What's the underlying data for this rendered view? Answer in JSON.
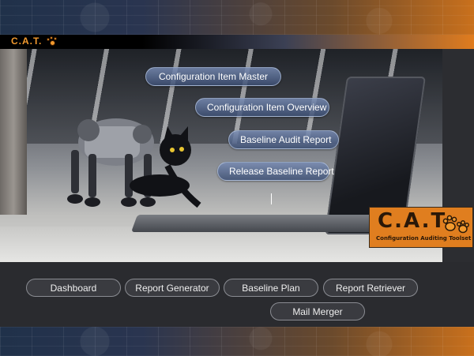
{
  "app": {
    "brand": "C.A.T.",
    "logo_title": "C.A.T.",
    "logo_subtitle": "Configuration Auditing Toolset"
  },
  "hero_links": [
    {
      "label": "Configuration Item Master"
    },
    {
      "label": "Configuration Item Overview"
    },
    {
      "label": "Baseline Audit Report"
    },
    {
      "label": "Release Baseline Report"
    }
  ],
  "nav": [
    {
      "label": "Dashboard"
    },
    {
      "label": "Report Generator"
    },
    {
      "label": "Baseline Plan"
    },
    {
      "label": "Report Retriever"
    },
    {
      "label": "Mail Merger"
    }
  ],
  "colors": {
    "accent": "#f29a2e",
    "logo_bg": "#e07e1f",
    "nav_bg": "#2a2b2f"
  },
  "icons": {
    "brand": "paw-icon",
    "logo": "paw-icon"
  }
}
